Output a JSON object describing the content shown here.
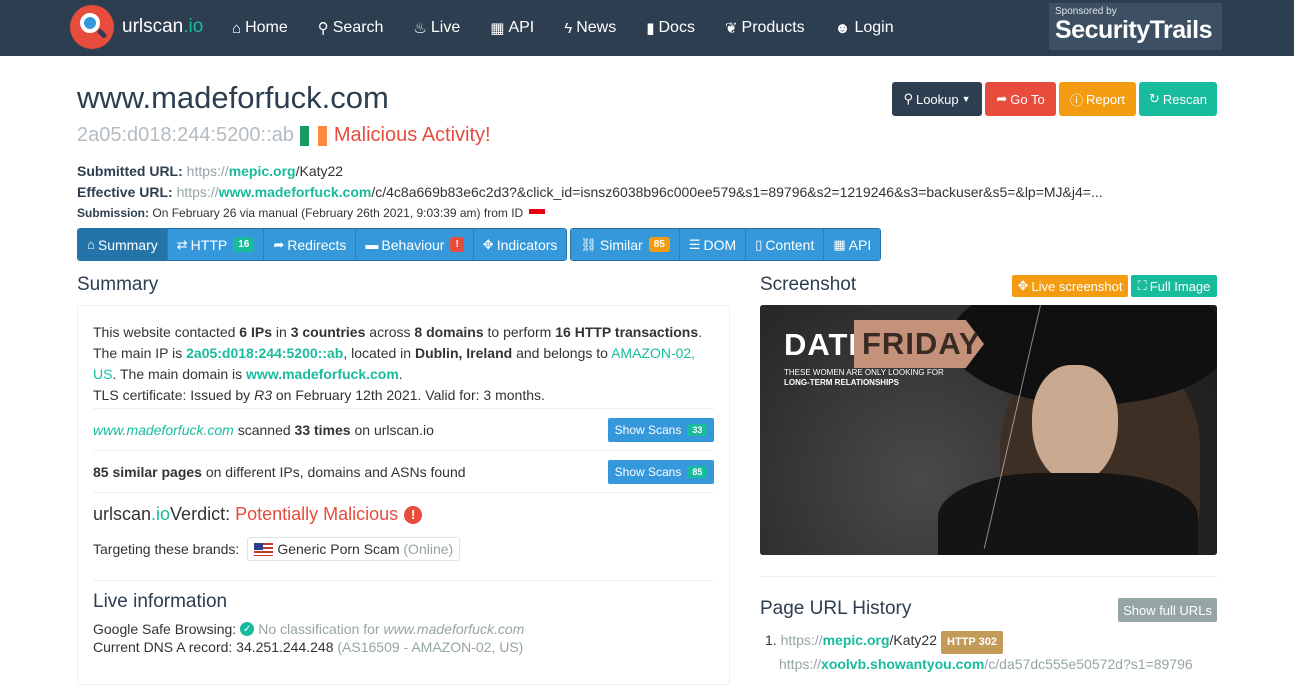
{
  "nav": {
    "brand_name": "urlscan",
    "brand_suffix": ".io",
    "links": [
      {
        "label": "Home",
        "icon": "home-icon"
      },
      {
        "label": "Search",
        "icon": "search-icon"
      },
      {
        "label": "Live",
        "icon": "fire-icon"
      },
      {
        "label": "API",
        "icon": "qrcode-icon"
      },
      {
        "label": "News",
        "icon": "bolt-icon"
      },
      {
        "label": "Docs",
        "icon": "bookmark-icon"
      },
      {
        "label": "Products",
        "icon": "leaf-icon"
      },
      {
        "label": "Login",
        "icon": "user-icon"
      }
    ],
    "sponsor_small": "Sponsored by",
    "sponsor_big": "SecurityTrails"
  },
  "header": {
    "title": "www.madeforfuck.com",
    "ip": "2a05:d018:244:5200::ab",
    "status": "Malicious Activity!",
    "flag_colors": [
      "#169b62",
      "#ffffff",
      "#ff883e"
    ]
  },
  "actions": {
    "lookup": "Lookup",
    "goto": "Go To",
    "report": "Report",
    "rescan": "Rescan"
  },
  "urlinfo": {
    "submitted_label": "Submitted URL:",
    "submitted_scheme": "https://",
    "submitted_domain": "mepic.org",
    "submitted_path": "/Katy22",
    "effective_label": "Effective URL:",
    "effective_scheme": "https://",
    "effective_domain": "www.madeforfuck.com",
    "effective_path": "/c/4c8a669b83e6c2d3?&click_id=isnsz6038b96c000ee579&s1=89796&s2=1219246&s3=backuser&s5=&lp=MJ&j4=...",
    "submission_label": "Submission:",
    "submission_text": "On February 26 via manual (February 26th 2021, 9:03:39 am) from ID"
  },
  "tabs": {
    "group1": [
      {
        "label": "Summary",
        "icon": "home-icon",
        "badge": ""
      },
      {
        "label": "HTTP",
        "icon": "exchange-icon",
        "badge": "16"
      },
      {
        "label": "Redirects",
        "icon": "share-icon",
        "badge": ""
      },
      {
        "label": "Behaviour",
        "icon": "comment-icon",
        "badge": "!"
      },
      {
        "label": "Indicators",
        "icon": "crosshairs-icon",
        "badge": ""
      }
    ],
    "group2": [
      {
        "label": "Similar",
        "icon": "link-icon",
        "badge": "85"
      },
      {
        "label": "DOM",
        "icon": "list-icon",
        "badge": ""
      },
      {
        "label": "Content",
        "icon": "file-icon",
        "badge": ""
      },
      {
        "label": "API",
        "icon": "qrcode-icon",
        "badge": ""
      }
    ]
  },
  "summary": {
    "title": "Summary",
    "p1_a": "This website contacted ",
    "ips": "6 IPs",
    "p1_b": " in ",
    "countries": "3 countries",
    "p1_c": " across ",
    "domains": "8 domains",
    "p1_d": " to perform ",
    "transactions": "16 HTTP transactions",
    "p1_e": ".",
    "p2_a": "The main IP is ",
    "main_ip": "2a05:d018:244:5200::ab",
    "p2_b": ", located in ",
    "location": "Dublin, Ireland",
    "p2_c": " and belongs to ",
    "asn": "AMAZON-02, US",
    "p2_d": ". The main domain is ",
    "main_domain": "www.madeforfuck.com",
    "p2_e": ".",
    "tls_a": "TLS certificate: Issued by ",
    "tls_issuer": "R3",
    "tls_b": " on February 12th 2021. Valid for: 3 months.",
    "scanned_domain": "www.madeforfuck.com",
    "scanned_a": " scanned ",
    "scanned_times": "33 times",
    "scanned_b": " on urlscan.io",
    "show_scans": "Show Scans",
    "scans_badge": "33",
    "similar_count": "85 similar pages",
    "similar_b": " on different IPs, domains and ASNs found",
    "similar_badge": "85",
    "verdict_a": "urlscan",
    "verdict_io": ".io",
    "verdict_b": " Verdict: ",
    "verdict_value": "Potentially Malicious",
    "targeting": "Targeting these brands:",
    "brand": "Generic Porn Scam",
    "brand_status": "(Online)",
    "live_title": "Live information",
    "gsb_label": "Google Safe Browsing:",
    "gsb_text": "No classification for",
    "gsb_domain": "www.madeforfuck.com",
    "dns_label": "Current DNS A record:",
    "dns_value": "34.251.244.248",
    "dns_asn": "(AS16509 - AMAZON-02, US)"
  },
  "screenshot": {
    "title": "Screenshot",
    "live_btn": "Live screenshot",
    "full_btn": "Full Image",
    "ad_date": "DATE",
    "ad_friday": "FRIDAY",
    "ad_sub1": "These women are only looking for",
    "ad_sub2": "long-term relationships"
  },
  "history": {
    "title": "Page URL History",
    "show_full": "Show full URLs",
    "item1_scheme": "https://",
    "item1_domain": "mepic.org",
    "item1_path": "/Katy22",
    "item1_badge": "HTTP 302",
    "item2_scheme": "https://",
    "item2_domain": "xoolvb.showantyou.com",
    "item2_path": "/c/da57dc555e50572d?s1=89796"
  },
  "colors": {
    "navbar": "#2c3e50",
    "accent_red": "#e74c3c",
    "accent_green": "#18bc9c",
    "accent_blue": "#3498db",
    "accent_orange": "#f39c12"
  }
}
